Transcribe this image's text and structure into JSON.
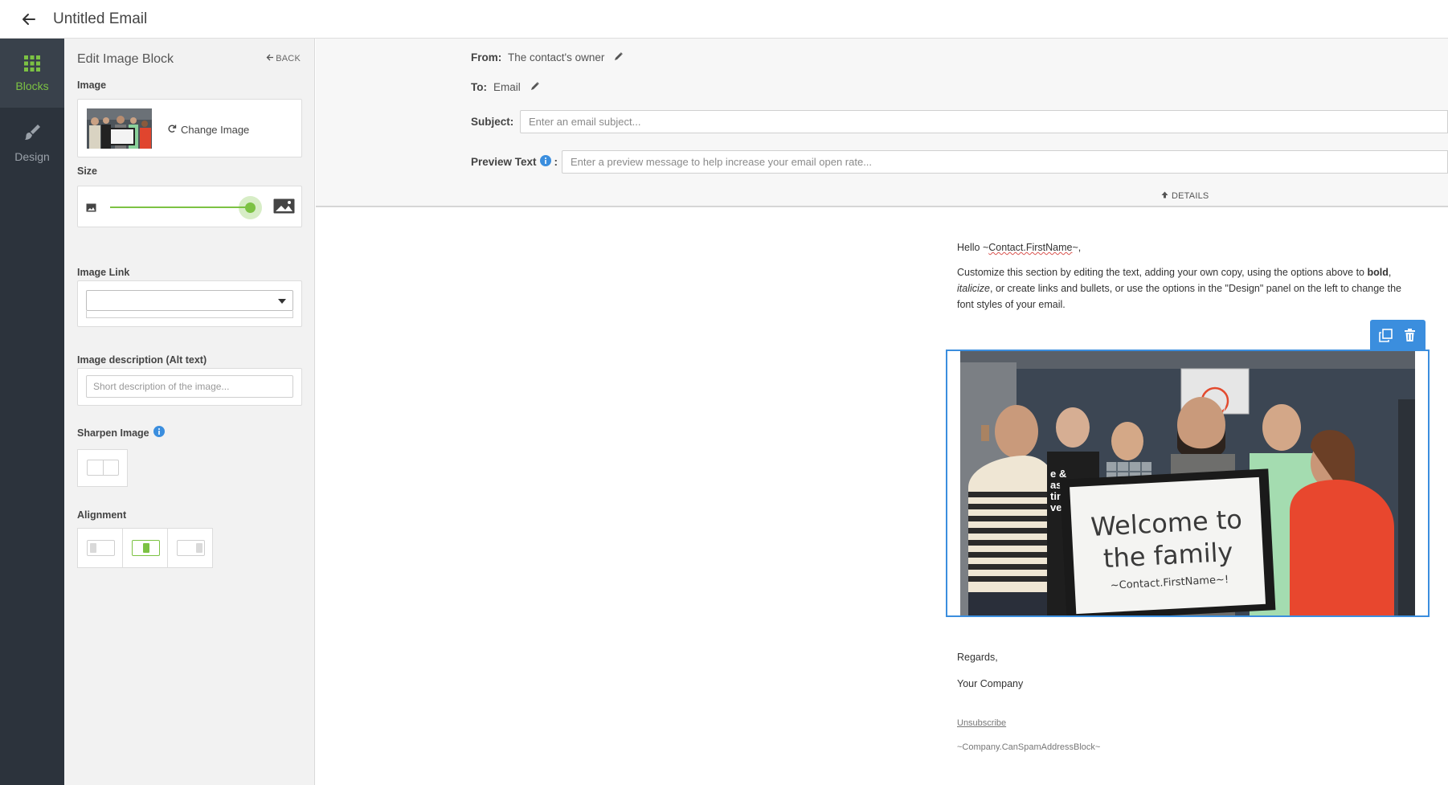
{
  "header": {
    "title": "Untitled Email"
  },
  "rail": {
    "items": [
      {
        "label": "Blocks",
        "icon": "grid-icon",
        "active": true
      },
      {
        "label": "Design",
        "icon": "brush-icon",
        "active": false
      }
    ]
  },
  "panel": {
    "title": "Edit Image Block",
    "back_label": "BACK",
    "image_label": "Image",
    "change_image_label": "Change Image",
    "size_label": "Size",
    "size_value_fraction": 0.92,
    "image_link_label": "Image Link",
    "image_link_value": "",
    "alt_label": "Image description (Alt text)",
    "alt_placeholder": "Short description of the image...",
    "alt_value": "",
    "sharpen_label": "Sharpen Image",
    "sharpen_on": false,
    "alignment_label": "Alignment",
    "alignment_options": [
      "left",
      "center",
      "right"
    ],
    "alignment_selected": "center"
  },
  "email_header": {
    "from_label": "From:",
    "from_value": "The contact's owner",
    "to_label": "To:",
    "to_value": "Email",
    "subject_label": "Subject:",
    "subject_placeholder": "Enter an email subject...",
    "subject_value": "",
    "preview_label": "Preview Text",
    "preview_colon": ":",
    "preview_placeholder": "Enter a preview message to help increase your email open rate...",
    "preview_value": "",
    "details_label": "DETAILS"
  },
  "email_body": {
    "greeting_prefix": "Hello ~",
    "greeting_token": "Contact.FirstName",
    "greeting_suffix": "~,",
    "para_1": "Customize this section by editing the text, adding your own copy, using the options above to ",
    "para_bold": "bold",
    "para_2": ", ",
    "para_italic": "italicize",
    "para_3": ", or create links and bullets, or use the options in the \"Design\" panel on the left to change the font styles of your email.",
    "sign_off": "Regards,",
    "company": "Your Company",
    "unsubscribe": "Unsubscribe",
    "address_block": "~Company.CanSpamAddressBlock~"
  },
  "photo": {
    "sign_line_1": "Welcome to",
    "sign_line_2": "the family",
    "sign_line_3": "~Contact.FirstName~!",
    "shirt_text": "e &\nas &\ntin &\nven"
  },
  "colors": {
    "accent_green": "#7cc243",
    "selection_blue": "#3b8ede",
    "rail_bg": "#2c333c",
    "info_blue": "#3b8ede"
  }
}
